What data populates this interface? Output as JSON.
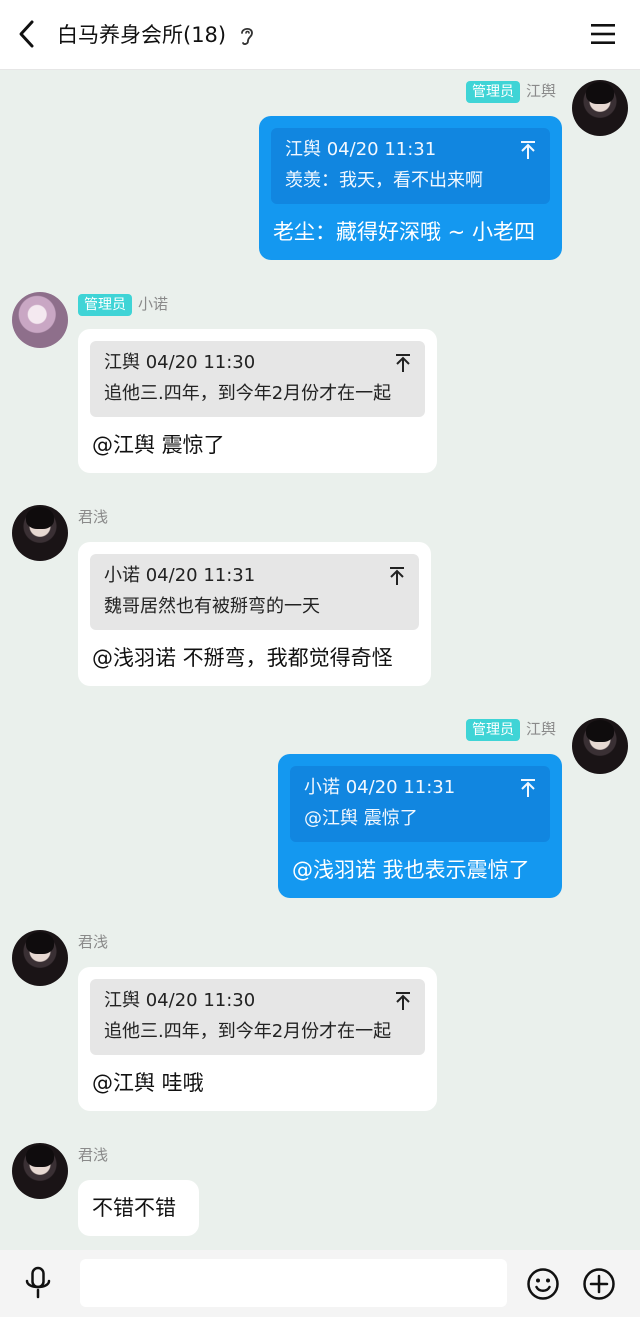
{
  "header": {
    "title": "白马养身会所(18)"
  },
  "messages": [
    {
      "side": "out",
      "badge": "管理员",
      "sender": "江舆",
      "quote_head": "江舆 04/20 11:31",
      "quote_text": "羡羡：我天，看不出来啊",
      "text": "老尘：藏得好深哦 ~ 小老四"
    },
    {
      "side": "in",
      "badge": "管理员",
      "sender": "小诺",
      "quote_head": "江舆 04/20 11:30",
      "quote_text": "追他三.四年，到今年2月份才在一起",
      "text": "@江舆 震惊了"
    },
    {
      "side": "in",
      "sender": "君浅",
      "quote_head": "小诺 04/20 11:31",
      "quote_text": "魏哥居然也有被掰弯的一天",
      "text": "@浅羽诺 不掰弯，我都觉得奇怪"
    },
    {
      "side": "out",
      "badge": "管理员",
      "sender": "江舆",
      "quote_head": "小诺 04/20 11:31",
      "quote_text": "@江舆 震惊了",
      "text": "@浅羽诺 我也表示震惊了"
    },
    {
      "side": "in",
      "sender": "君浅",
      "quote_head": "江舆 04/20 11:30",
      "quote_text": "追他三.四年，到今年2月份才在一起",
      "text": "@江舆 哇哦"
    },
    {
      "side": "in",
      "sender": "君浅",
      "text": "不错不错"
    }
  ],
  "input": {
    "placeholder": ""
  },
  "colors": {
    "outgoing_bubble": "#1498f0",
    "outgoing_quote": "#1186e0",
    "incoming_bubble": "#ffffff",
    "incoming_quote": "#e6e6e6",
    "admin_badge": "#3fd4d6",
    "chat_background": "#eaf0ec"
  },
  "icons": {
    "back": "chevron-left-icon",
    "ear": "ear-icon",
    "menu": "hamburger-menu-icon",
    "quote_jump": "jump-to-quote-icon",
    "mic": "microphone-icon",
    "emoji": "emoji-icon",
    "plus": "plus-icon"
  }
}
